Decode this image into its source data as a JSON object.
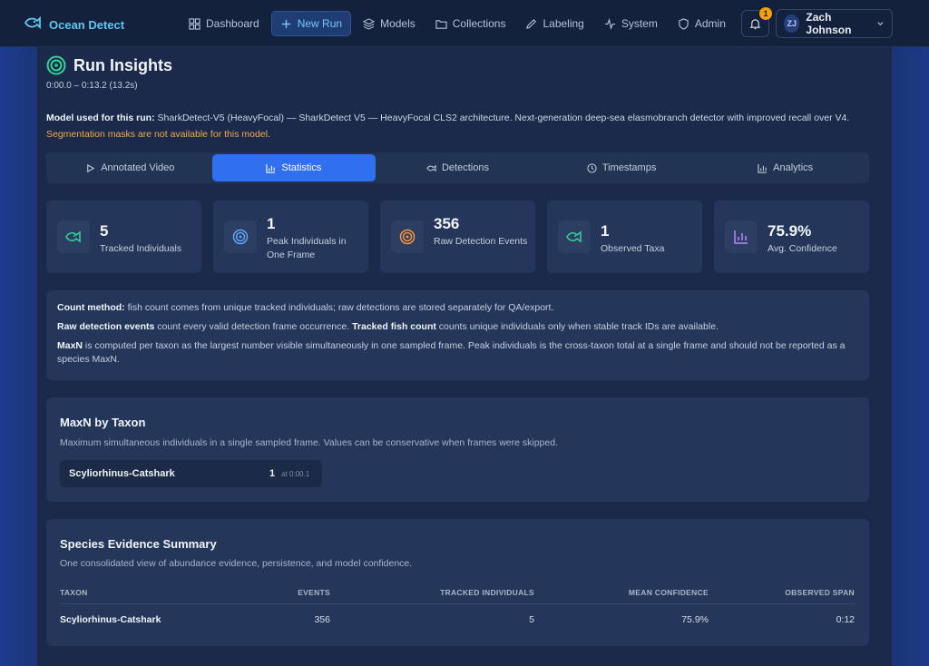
{
  "app": {
    "brand": "Ocean Detect"
  },
  "nav": {
    "items": [
      {
        "label": "Dashboard",
        "icon": "dashboard-icon"
      },
      {
        "label": "New Run",
        "icon": "plus-icon",
        "active": true
      },
      {
        "label": "Models",
        "icon": "layers-icon"
      },
      {
        "label": "Collections",
        "icon": "folder-icon"
      },
      {
        "label": "Labeling",
        "icon": "pencil-icon"
      },
      {
        "label": "System",
        "icon": "activity-icon"
      },
      {
        "label": "Admin",
        "icon": "shield-icon"
      }
    ]
  },
  "notifications": {
    "count": "1"
  },
  "user": {
    "initials": "ZJ",
    "name": "Zach Johnson"
  },
  "page": {
    "title": "Run Insights",
    "range": "0:00.0 – 0:13.2 (13.2s)",
    "model_label": "Model used for this run:",
    "model_text": "SharkDetect-V5 (HeavyFocal) — SharkDetect V5 — HeavyFocal CLS2 architecture. Next-generation deep-sea elasmobranch detector with improved recall over V4.",
    "seg_note": "Segmentation masks are not available for this model."
  },
  "tabs": [
    {
      "label": "Annotated Video",
      "icon": "play-icon"
    },
    {
      "label": "Statistics",
      "icon": "bar-chart-icon",
      "active": true
    },
    {
      "label": "Detections",
      "icon": "fish-icon"
    },
    {
      "label": "Timestamps",
      "icon": "clock-icon"
    },
    {
      "label": "Analytics",
      "icon": "bar-chart-icon"
    }
  ],
  "stats": [
    {
      "value": "5",
      "label": "Tracked Individuals",
      "icon": "fish-icon",
      "color": "#34d399"
    },
    {
      "value": "1",
      "label": "Peak Individuals in One Frame",
      "icon": "target-icon",
      "color": "#60a5fa"
    },
    {
      "value": "356",
      "label": "Raw Detection Events",
      "icon": "target-icon",
      "color": "#fb923c"
    },
    {
      "value": "1",
      "label": "Observed Taxa",
      "icon": "fish-icon",
      "color": "#34d399"
    },
    {
      "value": "75.9%",
      "label": "Avg. Confidence",
      "icon": "bar-chart-icon",
      "color": "#c084fc"
    }
  ],
  "method": {
    "p1_bold": "Count method:",
    "p1_text": " fish count comes from unique tracked individuals; raw detections are stored separately for QA/export.",
    "p2_bold_a": "Raw detection events",
    "p2_text_a": " count every valid detection frame occurrence. ",
    "p2_bold_b": "Tracked fish count",
    "p2_text_b": " counts unique individuals only when stable track IDs are available.",
    "p3_bold": "MaxN",
    "p3_text": " is computed per taxon as the largest number visible simultaneously in one sampled frame. Peak individuals is the cross-taxon total at a single frame and should not be reported as a species MaxN."
  },
  "maxn": {
    "title": "MaxN by Taxon",
    "subtitle": "Maximum simultaneous individuals in a single sampled frame. Values can be conservative when frames were skipped.",
    "items": [
      {
        "taxon": "Scyliorhinus-Catshark",
        "count": "1",
        "at": "at 0:00.1"
      }
    ]
  },
  "species": {
    "title": "Species Evidence Summary",
    "subtitle": "One consolidated view of abundance evidence, persistence, and model confidence.",
    "columns": [
      "TAXON",
      "EVENTS",
      "TRACKED INDIVIDUALS",
      "MEAN CONFIDENCE",
      "OBSERVED SPAN"
    ],
    "rows": [
      [
        "Scyliorhinus-Catshark",
        "356",
        "5",
        "75.9%",
        "0:12"
      ]
    ]
  }
}
